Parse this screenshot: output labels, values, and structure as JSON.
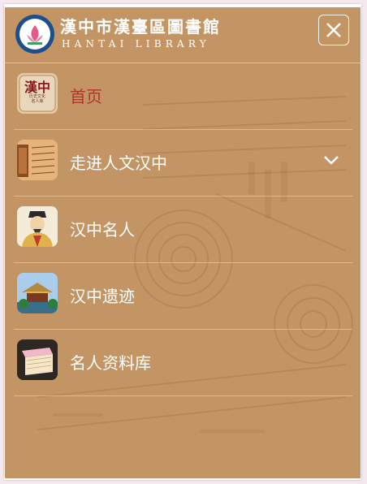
{
  "header": {
    "title": "漢中市漢臺區圖書館",
    "subtitle": "HANTAI LIBRARY",
    "close_icon": "close-icon"
  },
  "menu": {
    "items": [
      {
        "label": "首页",
        "active": true,
        "icon": "seal-thumbnail"
      },
      {
        "label": "走进人文汉中",
        "has_submenu": true,
        "icon": "scroll-thumbnail"
      },
      {
        "label": "汉中名人",
        "icon": "portrait-thumbnail"
      },
      {
        "label": "汉中遗迹",
        "icon": "pavilion-thumbnail"
      },
      {
        "label": "名人资料库",
        "icon": "books-thumbnail"
      }
    ],
    "seal_text": "漢中",
    "seal_caption": "历史文化名人库"
  },
  "colors": {
    "panel_bg": "#c49564",
    "active_text": "#b0342a",
    "text": "#ffffff"
  }
}
